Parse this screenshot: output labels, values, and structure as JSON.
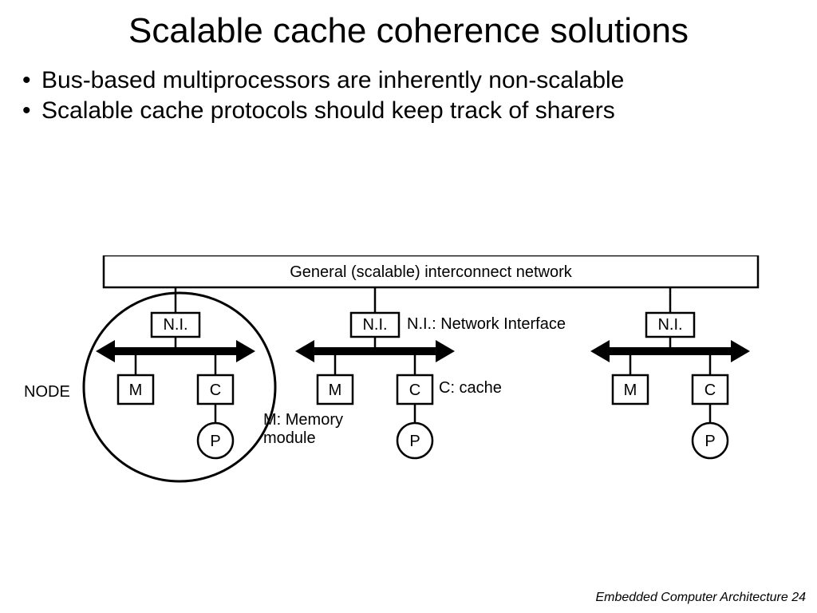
{
  "title": "Scalable cache coherence solutions",
  "bullets": [
    "Bus-based multiprocessors are inherently non-scalable",
    "Scalable cache protocols should keep track of sharers"
  ],
  "diagram": {
    "interconnect": "General (scalable) interconnect network",
    "node_label": "NODE",
    "ni_legend": "N.I.: Network Interface",
    "c_legend": "C: cache",
    "m_legend": "M: Memory\nmodule",
    "ni": "N.I.",
    "m": "M",
    "c": "C",
    "p": "P"
  },
  "footer": "Embedded Computer Architecture  24"
}
